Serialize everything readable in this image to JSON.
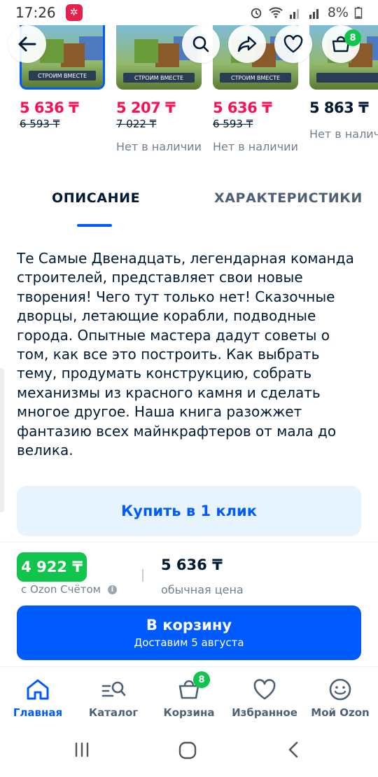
{
  "status_bar": {
    "time": "17:26",
    "battery": "8%"
  },
  "variants": [
    {
      "price": "5 636 ₸",
      "old_price": "6 593 ₸",
      "stock": "",
      "cover_title": "СТРОИМ ВМЕСТЕ",
      "selected": true
    },
    {
      "price": "5 207 ₸",
      "old_price": "7 022 ₸",
      "stock": "Нет в наличии",
      "cover_title": "СТРОИМ ВМЕСТЕ",
      "selected": false
    },
    {
      "price": "5 636 ₸",
      "old_price": "6 593 ₸",
      "stock": "Нет в наличии",
      "cover_title": "СТРОИМ ВМЕСТЕ",
      "selected": false
    },
    {
      "price": "5 863 ₸",
      "old_price": "",
      "stock": "Нет в наличии",
      "cover_title": "",
      "selected": false
    }
  ],
  "header_actions": {
    "cart_count": "8"
  },
  "tabs": {
    "description": "ОПИСАНИЕ",
    "characteristics": "ХАРАКТЕРИСТИКИ"
  },
  "description_text": "Те Самые Двенадцать, легендарная команда строителей, представляет свои новые творения! Чего тут только нет! Сказочные дворцы, летающие корабли, подводные города. Опытные мастера дадут советы о том, как все это построить. Как выбрать тему, продумать конструкцию, собрать механизмы из красного камня и сделать многое другое. Наша книга разожжет фантазию всех майнкрафтеров от мала до велика.",
  "one_click_label": "Купить в 1 клик",
  "pricing": {
    "ozon_price": "4 922 ₸",
    "ozon_price_label": "с Ozon Счётом",
    "regular_price": "5 636 ₸",
    "regular_price_label": "обычная цена"
  },
  "cart_button": {
    "label": "В корзину",
    "sublabel": "Доставим 5 августа"
  },
  "bottom_nav": [
    {
      "label": "Главная",
      "icon": "home-icon",
      "active": true
    },
    {
      "label": "Каталог",
      "icon": "catalog-icon",
      "active": false
    },
    {
      "label": "Корзина",
      "icon": "cart-icon",
      "active": false,
      "badge": "8"
    },
    {
      "label": "Избранное",
      "icon": "heart-icon",
      "active": false
    },
    {
      "label": "Мой Ozon",
      "icon": "profile-icon",
      "active": false
    }
  ],
  "colors": {
    "accent": "#005bff",
    "sale": "#f91155",
    "green": "#10c44c"
  }
}
